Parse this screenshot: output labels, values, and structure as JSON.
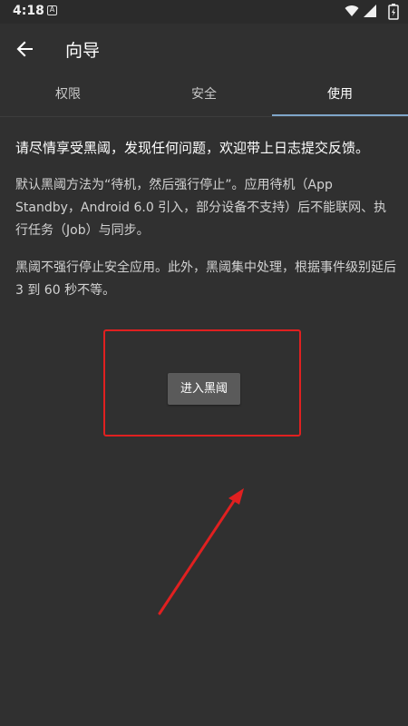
{
  "status_bar": {
    "time": "4:18",
    "notification_icon": "a-notification-icon"
  },
  "appbar": {
    "back_icon": "arrow-back-icon",
    "title": "向导"
  },
  "tabs": [
    {
      "label": "权限",
      "active": false
    },
    {
      "label": "安全",
      "active": false
    },
    {
      "label": "使用",
      "active": true
    }
  ],
  "content": {
    "paragraph1": "请尽情享受黑阈，发现任何问题，欢迎带上日志提交反馈。",
    "paragraph2": "默认黑阈方法为“待机，然后强行停止”。应用待机（App Standby，Android 6.0 引入，部分设备不支持）后不能联网、执行任务（Job）与同步。",
    "paragraph3": "黑阈不强行停止安全应用。此外，黑阈集中处理，根据事件级别延后 3 到 60 秒不等。"
  },
  "enter_button": {
    "label": "进入黑阈"
  },
  "colors": {
    "background": "#303030",
    "tab_indicator": "#7fa6c9",
    "annotation_red": "#e02020",
    "button_bg": "#5a5a5a"
  }
}
